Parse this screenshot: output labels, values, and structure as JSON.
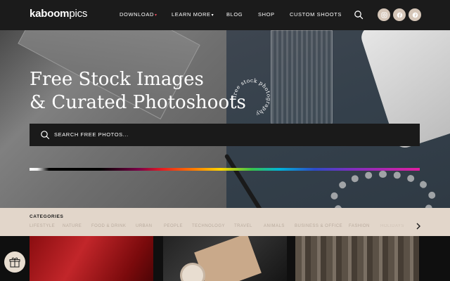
{
  "header": {
    "logo_bold": "kaboom",
    "logo_light": "pics",
    "nav": [
      {
        "label": "DOWNLOAD",
        "has_dropdown": true
      },
      {
        "label": "LEARN MORE",
        "has_dropdown": true
      },
      {
        "label": "BLOG"
      },
      {
        "label": "SHOP"
      },
      {
        "label": "CUSTOM SHOOTS"
      }
    ],
    "icons": [
      "search-icon",
      "instagram-icon",
      "facebook-icon",
      "pinterest-icon"
    ]
  },
  "hero": {
    "title_line1": "Free Stock Images",
    "title_line2": "& Curated Photoshoots",
    "badge_text": "free stock photography",
    "search_placeholder": "SEARCH FREE PHOTOS..."
  },
  "categories": {
    "title": "CATEGORIES",
    "items": [
      "LIFESTYLE",
      "NATURE",
      "FOOD & DRINK",
      "URBAN",
      "PEOPLE",
      "TECHNOLOGY",
      "TRAVEL",
      "ANIMALS",
      "BUSINESS & OFFICE",
      "FASHION",
      "HOLIDAYS"
    ]
  },
  "colors": {
    "header_bg": "#1b1b1b",
    "categories_bg": "#e2d6ca",
    "social_bg": "#d5c6b8",
    "dropdown_accent": "#e24b5a"
  }
}
